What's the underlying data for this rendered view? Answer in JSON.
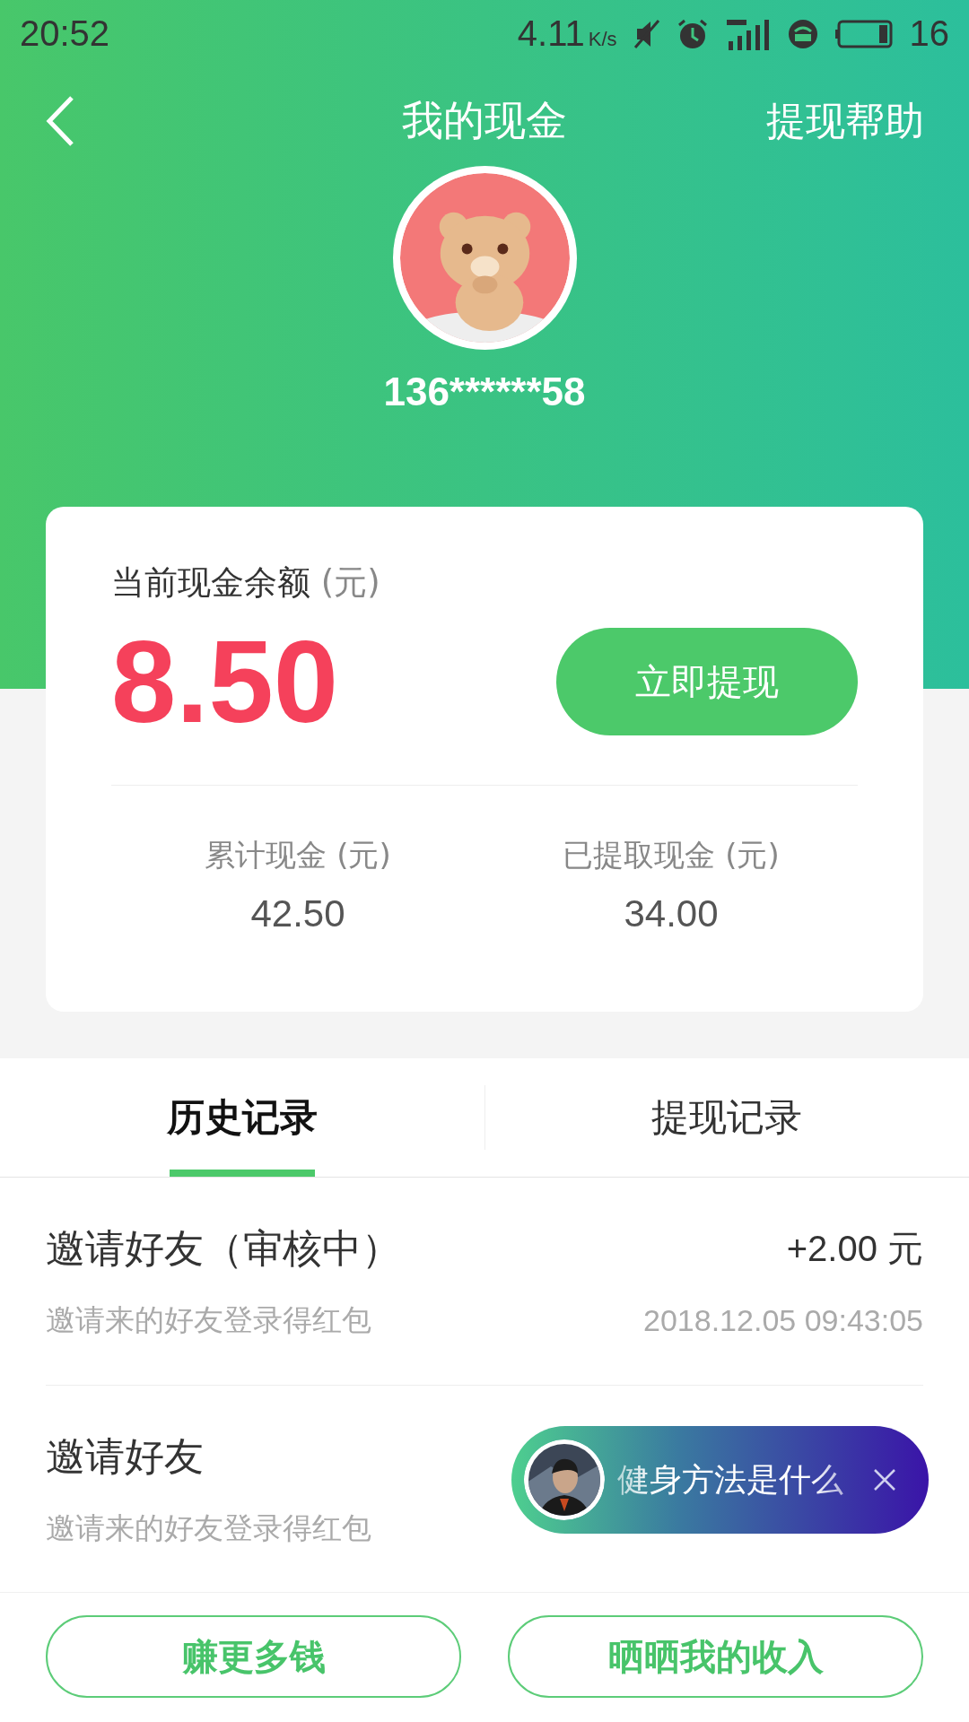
{
  "status_bar": {
    "time": "20:52",
    "speed": "4.11",
    "speed_unit": "K/s",
    "battery": "16"
  },
  "header": {
    "title": "我的现金",
    "action": "提现帮助"
  },
  "profile": {
    "phone": "136******58"
  },
  "balance_card": {
    "label": "当前现金余额",
    "unit": "(元)",
    "amount": "8.50",
    "button": "立即提现",
    "stats": [
      {
        "label": "累计现金",
        "unit": "(元)",
        "value": "42.50"
      },
      {
        "label": "已提取现金",
        "unit": "(元)",
        "value": "34.00"
      }
    ]
  },
  "tabs": [
    {
      "label": "历史记录",
      "selected": true
    },
    {
      "label": "提现记录",
      "selected": false
    }
  ],
  "records": [
    {
      "title": "邀请好友（审核中）",
      "subtitle": "邀请来的好友登录得红包",
      "amount": "+2.00 元",
      "time": "2018.12.05 09:43:05"
    },
    {
      "title": "邀请好友",
      "subtitle": "邀请来的好友登录得红包"
    }
  ],
  "popup": {
    "text": "健身方法是什么"
  },
  "bottom_buttons": [
    "赚更多钱",
    "晒晒我的收入"
  ]
}
